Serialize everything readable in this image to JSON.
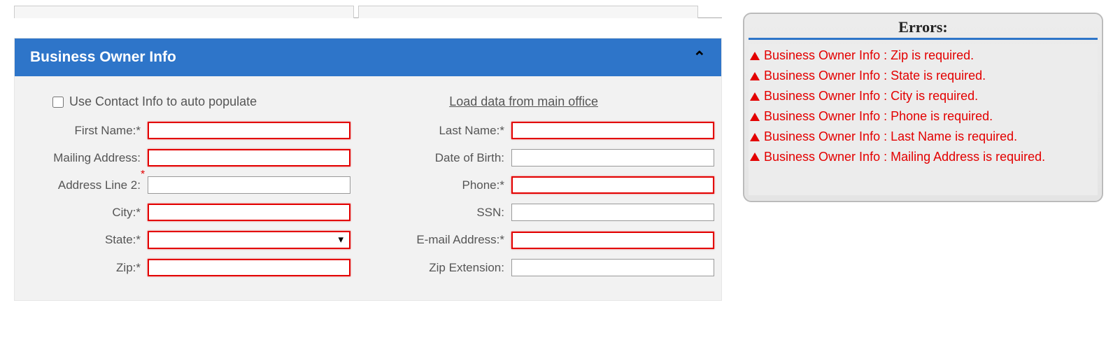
{
  "panel": {
    "title": "Business Owner Info",
    "checkbox_label": "Use Contact Info to auto populate",
    "load_link": "Load data from main office"
  },
  "labels": {
    "first_name": "First Name:",
    "last_name": "Last Name:",
    "mailing_address": "Mailing Address:",
    "date_of_birth": "Date of Birth:",
    "address_line2": "Address Line 2:",
    "phone": "Phone:",
    "city": "City:",
    "ssn": "SSN:",
    "state": "State:",
    "email": "E-mail Address:",
    "zip": "Zip:",
    "zip_ext": "Zip Extension:"
  },
  "values": {
    "first_name": "",
    "last_name": "",
    "mailing_address": "",
    "date_of_birth": "",
    "address_line2": "",
    "phone": "",
    "city": "",
    "ssn": "",
    "state": "",
    "email": "",
    "zip": "",
    "zip_ext": ""
  },
  "errors": {
    "title": "Errors:",
    "items": [
      "Business Owner Info : Zip is required.",
      "Business Owner Info : State is required.",
      "Business Owner Info : City is required.",
      "Business Owner Info : Phone is required.",
      "Business Owner Info : Last Name is required.",
      "Business Owner Info : Mailing Address is required."
    ]
  }
}
